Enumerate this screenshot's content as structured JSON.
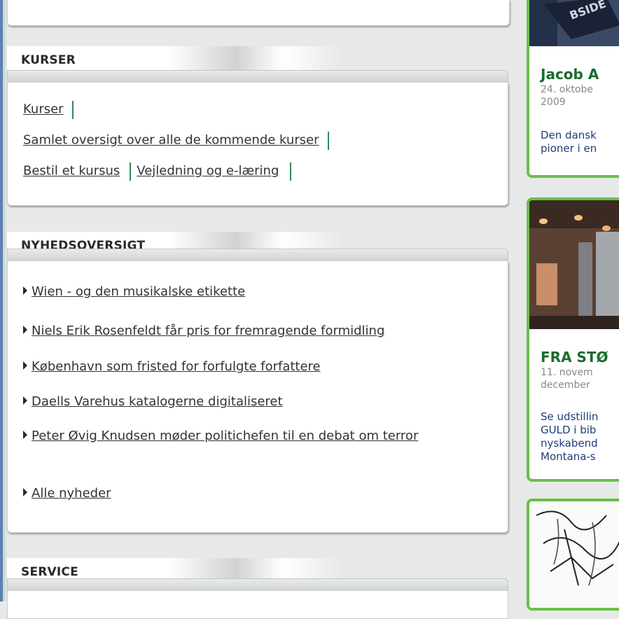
{
  "kurser": {
    "heading": "KURSER",
    "links": [
      "Kurser",
      "Samlet oversigt over alle de kommende kurser",
      "Bestil et kursus",
      "Vejledning og e-læring"
    ]
  },
  "nyheder": {
    "heading": "NYHEDSOVERSIGT",
    "items": [
      "Wien - og den musikalske etikette",
      "Niels Erik Rosenfeldt får pris for fremragende formidling",
      "København som fristed for forfulgte forfattere",
      "Daells Varehus katalogerne digitaliseret",
      "Peter Øvig Knudsen møder politichefen til en debat om terror",
      "Alle nyheder"
    ]
  },
  "service": {
    "heading": "SERVICE"
  },
  "sidebar": {
    "card1": {
      "title": "Jacob A",
      "date_line1": "24. oktobe",
      "date_line2": "2009",
      "text_line1": "Den dansk",
      "text_line2": "pioner i en"
    },
    "card2": {
      "title": "FRA STØ",
      "date_line1": "11. novem",
      "date_line2": "december",
      "text_line1": "Se udstillin",
      "text_line2": "GULD i bib",
      "text_line3": "nyskabend",
      "text_line4": "Montana-s"
    }
  },
  "colors": {
    "accent_green": "#6cbf4a",
    "title_green": "#1d6b2f",
    "separator": "#2e8b57",
    "left_border": "#5b7fb8"
  }
}
